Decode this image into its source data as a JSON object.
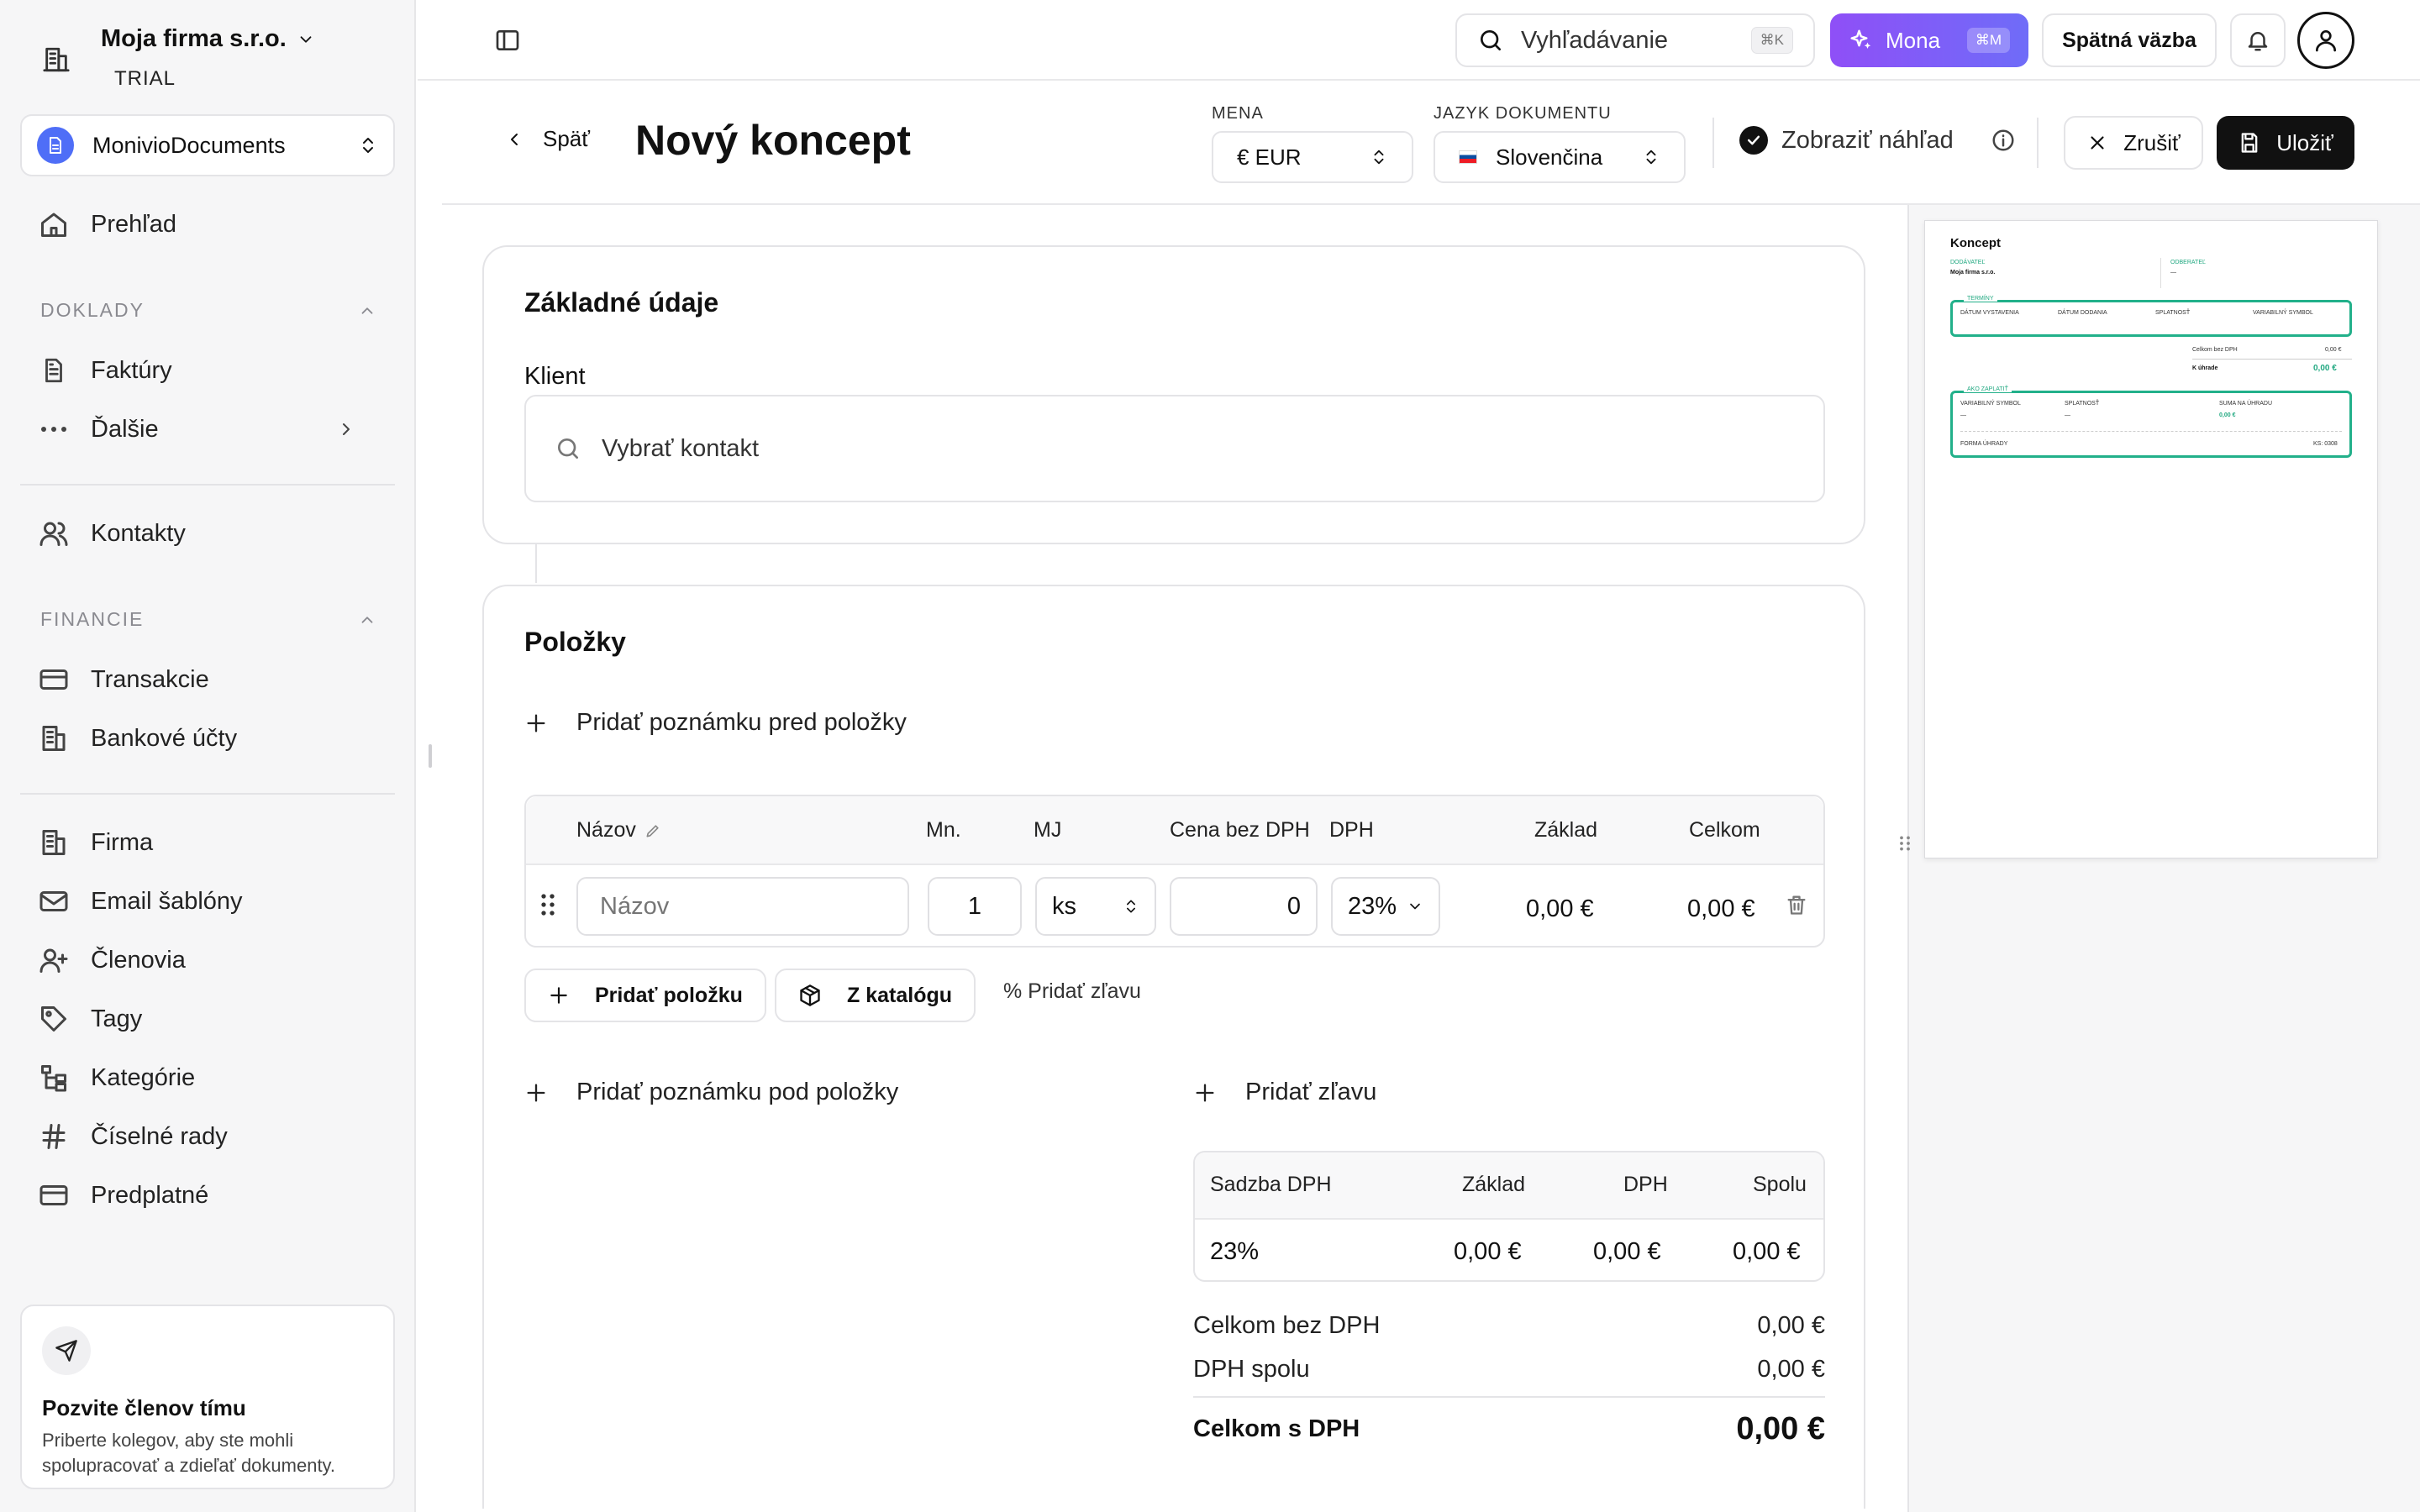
{
  "sidebar": {
    "company_name": "Moja firma s.r.o.",
    "company_plan": "TRIAL",
    "workspace": "MonivioDocuments",
    "overview": "Prehľad",
    "section_documents": "DOKLADY",
    "invoices": "Faktúry",
    "more": "Ďalšie",
    "contacts": "Kontakty",
    "section_finance": "FINANCIE",
    "transactions": "Transakcie",
    "bank_accounts": "Bankové účty",
    "company": "Firma",
    "email_templates": "Email šablóny",
    "members": "Členovia",
    "tags": "Tagy",
    "categories": "Kategórie",
    "number_series": "Číselné rady",
    "subscription": "Predplatné",
    "invite_title": "Pozvite členov tímu",
    "invite_text": "Priberte kolegov, aby ste mohli spolupracovať a zdieľať dokumenty."
  },
  "topbar": {
    "search_label": "Vyhľadávanie",
    "search_shortcut": "⌘K",
    "mona_label": "Mona",
    "mona_shortcut": "⌘M",
    "feedback_label": "Spätná väzba"
  },
  "header": {
    "back_label": "Späť",
    "title": "Nový koncept",
    "currency_label": "MENA",
    "currency_value": "€ EUR",
    "language_label": "JAZYK DOKUMENTU",
    "language_value": "Slovenčina",
    "preview_label": "Zobraziť náhľad",
    "cancel_label": "Zrušiť",
    "save_label": "Uložiť"
  },
  "basic_info": {
    "title": "Základné údaje",
    "client_label": "Klient",
    "client_placeholder": "Vybrať kontakt"
  },
  "items": {
    "title": "Položky",
    "add_note_before": "Pridať poznámku pred položky",
    "columns": {
      "name": "Názov",
      "qty": "Mn.",
      "unit": "MJ",
      "price": "Cena bez DPH",
      "vat": "DPH",
      "base": "Základ",
      "total": "Celkom"
    },
    "row": {
      "name_placeholder": "Názov",
      "qty": "1",
      "unit": "ks",
      "price": "0",
      "vat": "23%",
      "base": "0,00 €",
      "total": "0,00 €"
    },
    "add_item": "Pridať položku",
    "from_catalog": "Z katalógu",
    "add_discount_small": "% Pridať zľavu",
    "add_note_after": "Pridať poznámku pod položky",
    "add_discount": "Pridať zľavu"
  },
  "vat_summary": {
    "columns": [
      "Sadzba DPH",
      "Základ",
      "DPH",
      "Spolu"
    ],
    "row": [
      "23%",
      "0,00 €",
      "0,00 €",
      "0,00 €"
    ],
    "total_without_vat_label": "Celkom bez DPH",
    "total_without_vat": "0,00 €",
    "vat_total_label": "DPH spolu",
    "vat_total": "0,00 €",
    "total_with_vat_label": "Celkom s DPH",
    "total_with_vat": "0,00 €"
  },
  "preview": {
    "title": "Koncept",
    "supplier_label": "DODÁVATEĽ",
    "supplier_name": "Moja firma s.r.o.",
    "customer_label": "ODBERATEĽ",
    "customer_value": "—",
    "terms_label": "TERMÍNY",
    "issue_date": "DÁTUM VYSTAVENIA",
    "delivery_date": "DÁTUM DODANIA",
    "due": "SPLATNOSŤ",
    "variable_symbol": "VARIABILNÝ SYMBOL",
    "dash": "—",
    "total_without_vat_label": "Celkom bez DPH",
    "total_without_vat": "0,00 €",
    "to_pay_label": "K úhrade",
    "to_pay": "0,00 €",
    "how_to_pay": "AKO ZAPLATIŤ",
    "amount_to_pay": "SUMA NA ÚHRADU",
    "payment_form": "FORMA ÚHRADY",
    "ks": "KS: 0308"
  },
  "colors": {
    "accent": "#8f4ff7",
    "primary_button": "#111111",
    "preview_accent": "#22b08a"
  }
}
